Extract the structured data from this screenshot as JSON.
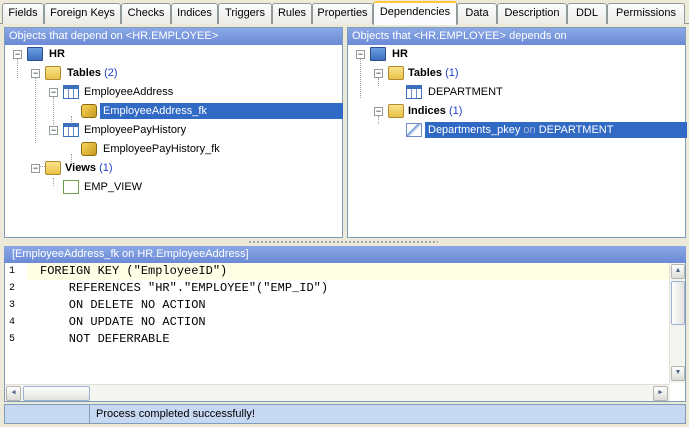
{
  "tabs": [
    "Fields",
    "Foreign Keys",
    "Checks",
    "Indices",
    "Triggers",
    "Rules",
    "Properties",
    "Dependencies",
    "Data",
    "Description",
    "DDL",
    "Permissions"
  ],
  "active_tab": "Dependencies",
  "left_panel": {
    "title": "Objects that depend on <HR.EMPLOYEE>",
    "root": "HR",
    "tables_label": "Tables",
    "tables_count": "(2)",
    "table1": "EmployeeAddress",
    "table1_child": "EmployeeAddress_fk",
    "table2": "EmployeePayHistory",
    "table2_child": "EmployeePayHistory_fk",
    "views_label": "Views",
    "views_count": "(1)",
    "view1": "EMP_VIEW"
  },
  "right_panel": {
    "title": "Objects that <HR.EMPLOYEE> depends on",
    "root": "HR",
    "tables_label": "Tables",
    "tables_count": "(1)",
    "table1": "DEPARTMENT",
    "indices_label": "Indices",
    "indices_count": "(1)",
    "index1_name": "Departments_pkey",
    "index1_on": "on",
    "index1_table": "DEPARTMENT"
  },
  "code_panel": {
    "title": "[EmployeeAddress_fk on HR.EmployeeAddress]",
    "lines": [
      {
        "no": "1",
        "text": "FOREIGN KEY (\"EmployeeID\")"
      },
      {
        "no": "2",
        "text": "    REFERENCES \"HR\".\"EMPLOYEE\"(\"EMP_ID\")"
      },
      {
        "no": "3",
        "text": "    ON DELETE NO ACTION"
      },
      {
        "no": "4",
        "text": "    ON UPDATE NO ACTION"
      },
      {
        "no": "5",
        "text": "    NOT DEFERRABLE"
      }
    ]
  },
  "status": {
    "message": "Process completed successfully!"
  }
}
